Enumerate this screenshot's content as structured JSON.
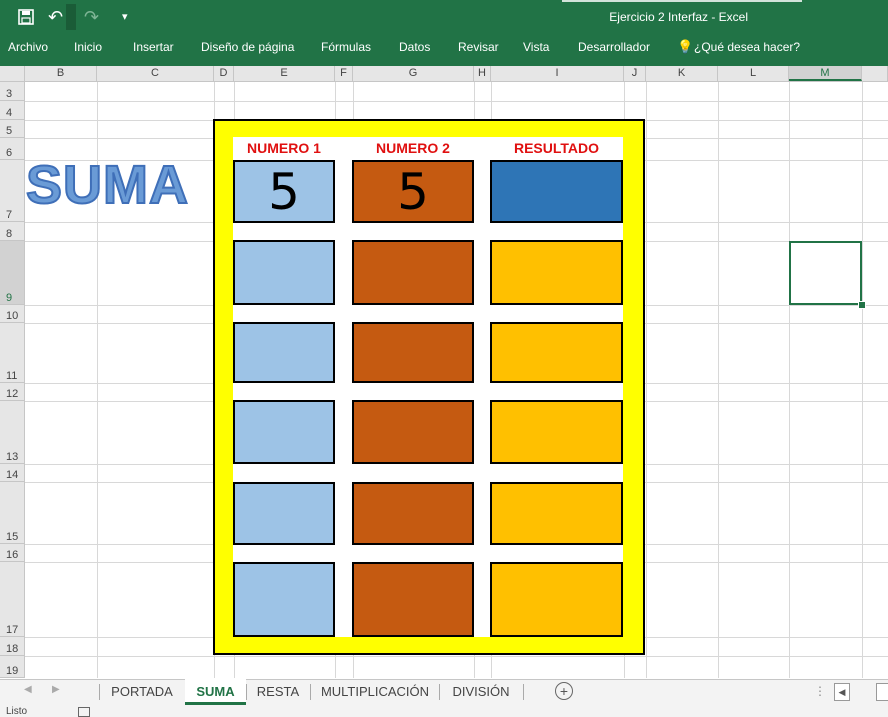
{
  "window": {
    "title": "Ejercicio 2 Interfaz - Excel"
  },
  "quick_access": {
    "save_icon": "save-icon",
    "undo_icon": "undo-icon",
    "redo_icon": "redo-icon",
    "customize_icon": "dropdown-icon"
  },
  "ribbon": {
    "tabs": [
      "Archivo",
      "Inicio",
      "Insertar",
      "Diseño de página",
      "Fórmulas",
      "Datos",
      "Revisar",
      "Vista",
      "Desarrollador"
    ],
    "search": "¿Qué desea hacer?"
  },
  "grid": {
    "columns": [
      "B",
      "C",
      "D",
      "E",
      "F",
      "G",
      "H",
      "I",
      "J",
      "K",
      "L",
      "M"
    ],
    "rows": [
      "3",
      "4",
      "5",
      "6",
      "7",
      "8",
      "9",
      "10",
      "11",
      "12",
      "13",
      "14",
      "15",
      "16",
      "17",
      "18",
      "19"
    ],
    "selected_column": "M",
    "selected_row": "9"
  },
  "sheet": {
    "title": "SUMA",
    "headers": [
      "NUMERO 1",
      "NUMERO 2",
      "RESULTADO"
    ],
    "rows": [
      {
        "n1": "5",
        "n2": "5",
        "res": ""
      },
      {
        "n1": "",
        "n2": "",
        "res": ""
      },
      {
        "n1": "",
        "n2": "",
        "res": ""
      },
      {
        "n1": "",
        "n2": "",
        "res": ""
      },
      {
        "n1": "",
        "n2": "",
        "res": ""
      },
      {
        "n1": "",
        "n2": "",
        "res": ""
      }
    ]
  },
  "sheet_tabs": [
    "PORTADA",
    "SUMA",
    "RESTA",
    "MULTIPLICACIÓN",
    "DIVISIÓN"
  ],
  "active_sheet": "SUMA",
  "status": {
    "text": "Listo"
  },
  "colors": {
    "accent": "#217346",
    "panel": "#ffff00",
    "num1": "#9dc3e6",
    "num2": "#c55a11",
    "result": "#ffc000",
    "result_first": "#2e75b6",
    "header_text": "#e01010"
  }
}
